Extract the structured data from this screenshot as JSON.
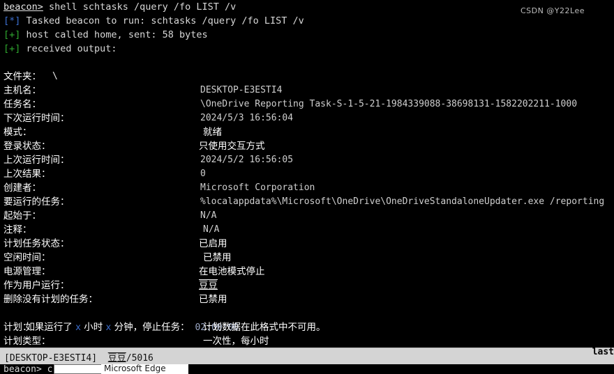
{
  "console": {
    "prompt_label": "beacon>",
    "command": " shell schtasks /query /fo LIST /v",
    "log_lines": [
      {
        "tag": "[*]",
        "tag_kind": "info",
        "text": " Tasked beacon to run: schtasks /query /fo LIST /v"
      },
      {
        "tag": "[+]",
        "tag_kind": "good",
        "text": " host called home, sent: 58 bytes"
      },
      {
        "tag": "[+]",
        "tag_kind": "good",
        "text": " received output:"
      }
    ],
    "folder_row": {
      "label": "文件夹：",
      "value": "\\"
    },
    "rows": [
      {
        "label": "主机名：",
        "value": "DESKTOP-E3ESTI4",
        "style": "mono"
      },
      {
        "label": "任务名：",
        "value": "\\OneDrive Reporting Task-S-1-5-21-1984339088-38698131-1582202211-1000",
        "style": "mono"
      },
      {
        "label": "下次运行时间：",
        "value": "2024/5/3 16:56:04",
        "style": "mono"
      },
      {
        "label": "模式：",
        "value": "就绪",
        "style": "cjk-indent"
      },
      {
        "label": "登录状态：",
        "value": "只使用交互方式",
        "style": "cjk"
      },
      {
        "label": "上次运行时间：",
        "value": "2024/5/2 16:56:05",
        "style": "mono"
      },
      {
        "label": "上次结果：",
        "value": "0",
        "style": "mono"
      },
      {
        "label": "创建者：",
        "value": "Microsoft Corporation",
        "style": "mono"
      },
      {
        "label": "要运行的任务：",
        "value": "%localappdata%\\Microsoft\\OneDrive\\OneDriveStandaloneUpdater.exe /reporting",
        "style": "mono"
      },
      {
        "label": "起始于：",
        "value": "N/A",
        "style": "mono"
      },
      {
        "label": "注释：",
        "value": "N/A",
        "style": "mono-indent"
      },
      {
        "label": "计划任务状态：",
        "value": "已启用",
        "style": "cjk"
      },
      {
        "label": "空闲时间：",
        "value": "已禁用",
        "style": "cjk-indent"
      },
      {
        "label": "电源管理：",
        "value": "在电池模式停止",
        "style": "cjk"
      },
      {
        "label": "作为用户运行：",
        "value": "豆豆",
        "style": "cjk-underline"
      },
      {
        "label": "删除没有计划的任务：",
        "value": "已禁用",
        "style": "cjk"
      }
    ],
    "stop_task_row": {
      "prefix": "如果运行了 ",
      "hours_token": "x",
      "mid1": " 小时 ",
      "minutes_token": "x",
      "mid2": " 分钟，停止任务：",
      "value": " 02:00:00"
    },
    "tail_rows": [
      {
        "label": "计划：",
        "value": "计划数据在此格式中不可用。",
        "style": "cjk-indent"
      },
      {
        "label": "计划类型：",
        "value": "一次性，每小时",
        "style": "cjk-indent"
      }
    ],
    "overflow_fragment": "last"
  },
  "statusbar": {
    "host": "[DESKTOP-E3ESTI4]",
    "user": "豆豆",
    "separator": "/",
    "pid": "5016"
  },
  "watermark": {
    "text": "CSDN @Y22Lee"
  },
  "bottom_strip": {
    "prompt": "beacon> c",
    "tab_label": "Microsoft Edge"
  },
  "colors": {
    "background": "#000000",
    "foreground": "#d8d8d8",
    "info_tag": "#3d6fd0",
    "good_tag": "#2fa82f",
    "statusbar_bg": "#d4d4d4",
    "statusbar_fg": "#111111",
    "label_fg": "#ffffff",
    "value_fg": "#cfcfcf"
  }
}
